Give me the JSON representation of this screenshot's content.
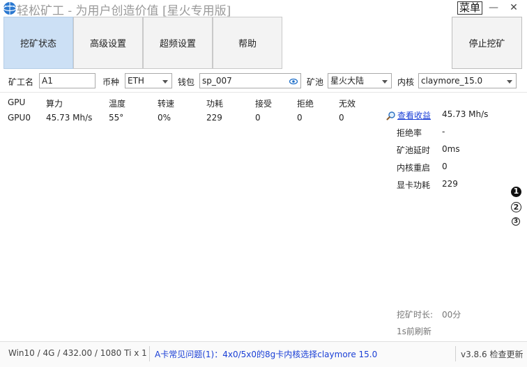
{
  "title": "轻松矿工 - 为用户创造价值 [星火专用版]",
  "menu_label": "菜单",
  "window_controls": {
    "minimize": "—",
    "close": "✕"
  },
  "tabs": [
    {
      "label": "挖矿状态",
      "active": true
    },
    {
      "label": "高级设置",
      "active": false
    },
    {
      "label": "超频设置",
      "active": false
    },
    {
      "label": "帮助",
      "active": false
    }
  ],
  "stop_button": "停止挖矿",
  "config": {
    "worker_label": "矿工名",
    "worker_value": "A1",
    "coin_label": "币种",
    "coin_value": "ETH",
    "wallet_label": "钱包",
    "wallet_value": "sp_007",
    "pool_label": "矿池",
    "pool_value": "星火大陆",
    "kernel_label": "内核",
    "kernel_value": "claymore_15.0"
  },
  "gpu_table": {
    "headers": [
      "GPU",
      "算力",
      "温度",
      "转速",
      "功耗",
      "接受",
      "拒绝",
      "无效"
    ],
    "rows": [
      [
        "GPU0",
        "45.73 Mh/s",
        "55°",
        "0%",
        "229",
        "0",
        "0",
        "0"
      ]
    ]
  },
  "stats": {
    "earnings_link": "查看收益",
    "hashrate": "45.73 Mh/s",
    "items": [
      {
        "label": "拒绝率",
        "value": "-"
      },
      {
        "label": "矿池延时",
        "value": "0ms"
      },
      {
        "label": "内核重启",
        "value": "0"
      },
      {
        "label": "显卡功耗",
        "value": "229"
      }
    ]
  },
  "page_indicators": [
    "1",
    "2",
    "3"
  ],
  "mining_time_label": "挖矿时长:",
  "mining_time_value": "00分",
  "refresh_text": "1s前刷新",
  "status_bar": {
    "system_info": "Win10  / 4G / 432.00 / 1080 Ti x 1",
    "tip": "A卡常见问题(1)：4x0/5x0的8g卡内核选择claymore 15.0",
    "version": "v3.8.6 检查更新"
  },
  "colors": {
    "active_tab": "#cce0f5",
    "link": "#1a3fd6",
    "title_gray": "#9a9a9a"
  },
  "icons": [
    "app-logo-icon",
    "eye-icon",
    "magnifier-icon",
    "chevron-down-icon"
  ]
}
